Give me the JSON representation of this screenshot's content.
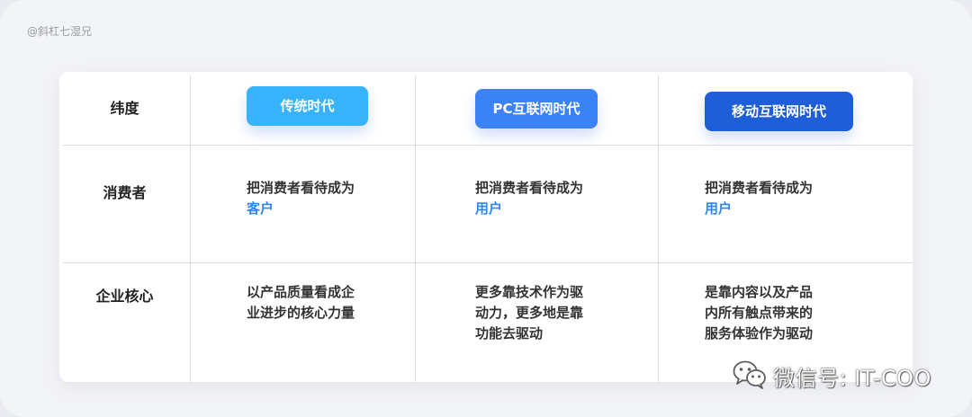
{
  "credit": "@斜杠七湿兄",
  "table": {
    "header_label": "纬度",
    "columns": [
      {
        "title": "传统时代",
        "color": "#36b3fa"
      },
      {
        "title": "PC互联网时代",
        "color": "#3a82f6"
      },
      {
        "title": "移动互联网时代",
        "color": "#1f5ed9"
      }
    ],
    "rows": [
      {
        "label": "消费者",
        "cells": [
          {
            "lines": [
              "把消费者看待成为"
            ],
            "highlight": "客户"
          },
          {
            "lines": [
              "把消费者看待成为"
            ],
            "highlight": "用户"
          },
          {
            "lines": [
              "把消费者看待成为"
            ],
            "highlight": "用户"
          }
        ]
      },
      {
        "label": "企业核心",
        "cells": [
          {
            "lines": [
              "以产品质量看成企",
              "业进步的核心力量"
            ]
          },
          {
            "lines": [
              "更多靠技术作为驱",
              "动力，更多地是靠",
              "功能去驱动"
            ]
          },
          {
            "lines": [
              "是靠内容以及产品",
              "内所有触点带来的",
              "服务体验作为驱动"
            ]
          }
        ]
      }
    ]
  },
  "watermark": {
    "text": "微信号: IT-COO",
    "icon": "wechat-icon"
  },
  "colors": {
    "highlight": "#2f86f6"
  }
}
